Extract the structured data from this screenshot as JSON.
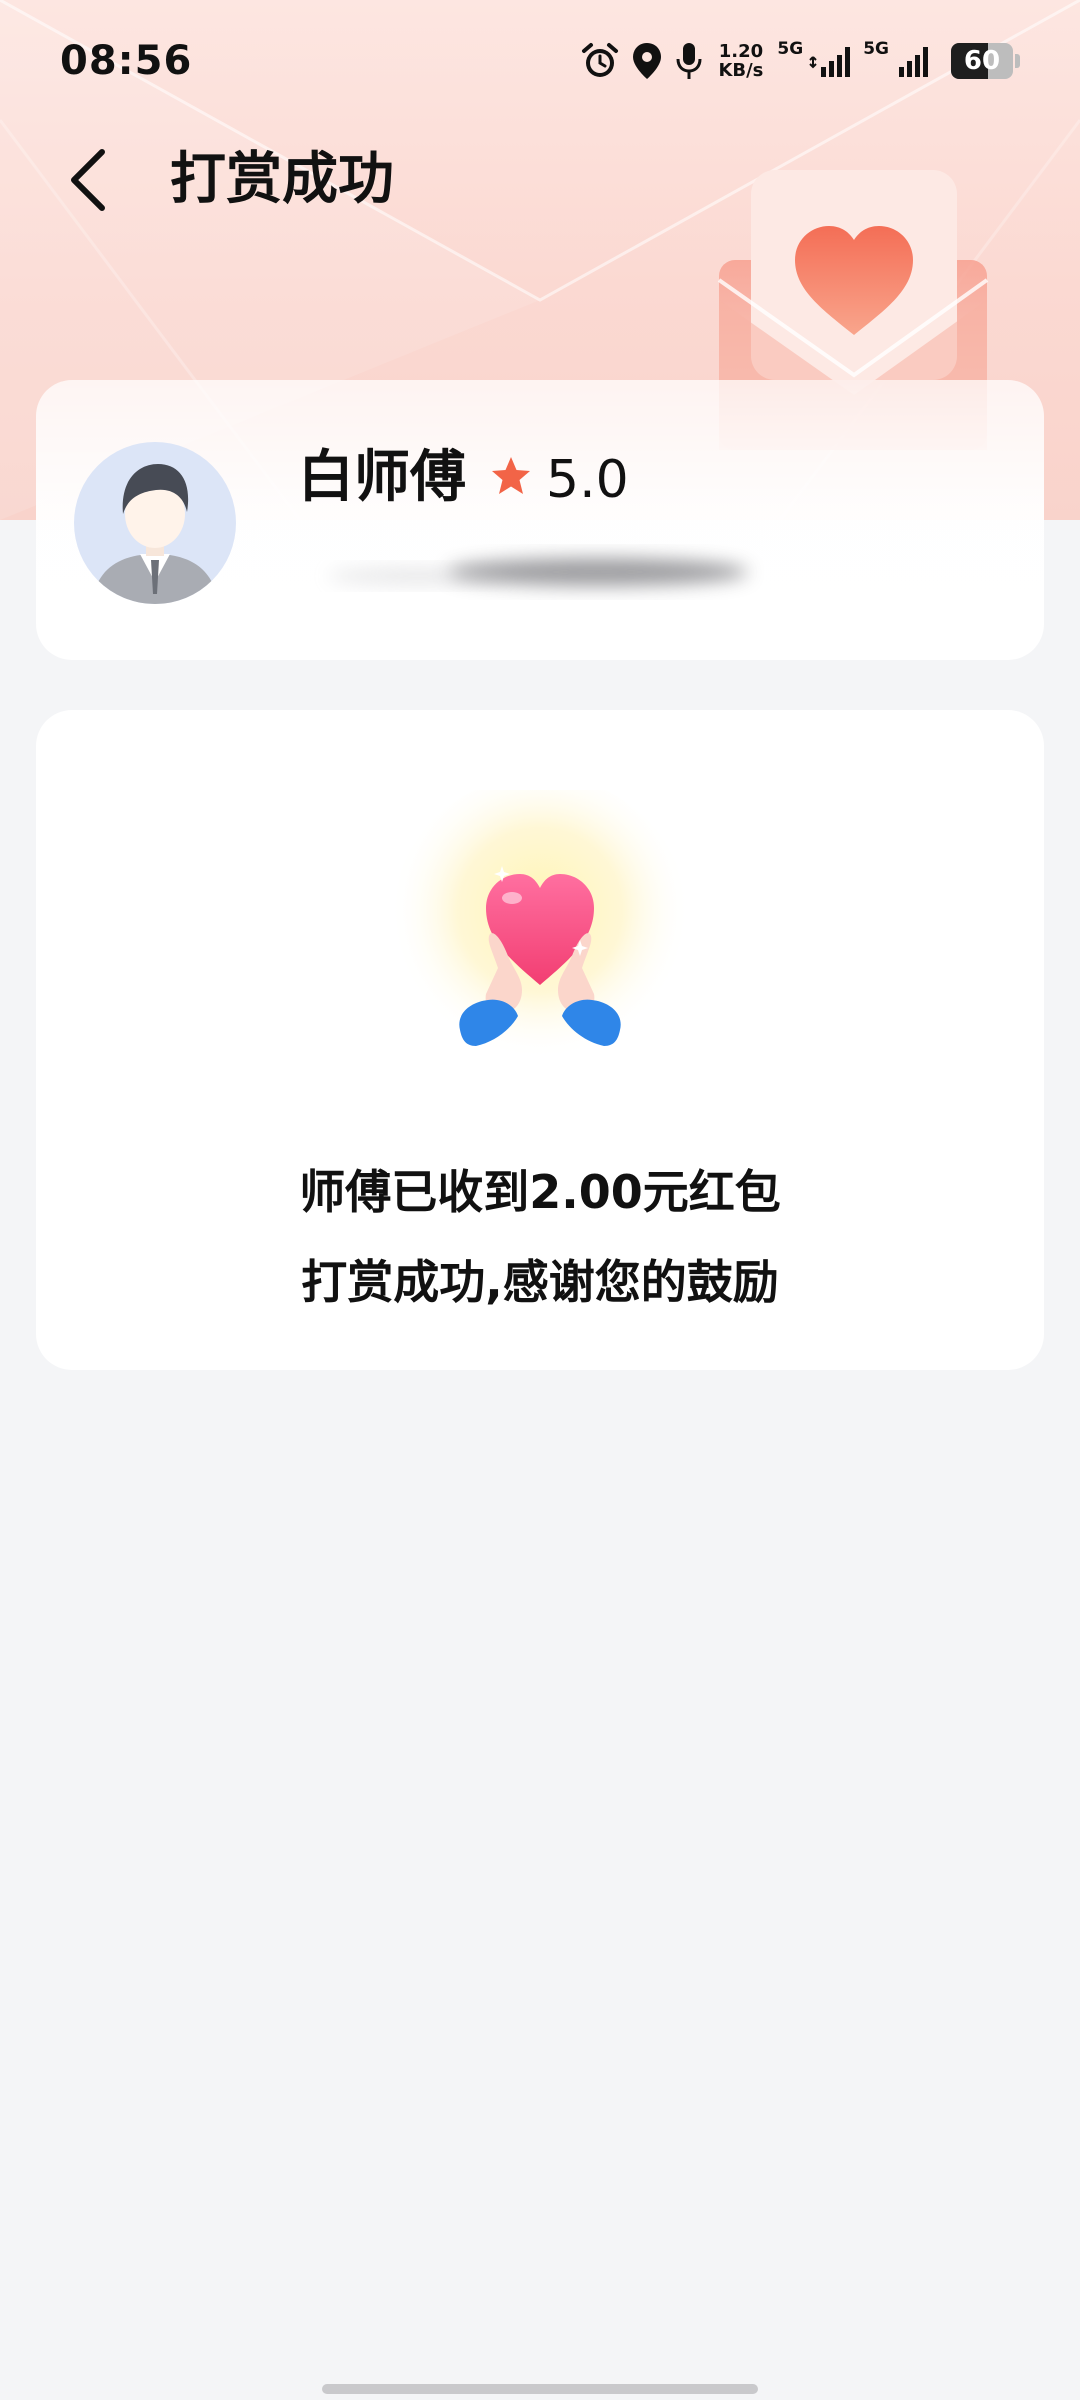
{
  "status_bar": {
    "time": "08:56",
    "net_speed_value": "1.20",
    "net_speed_unit": "KB/s",
    "signal_1_label": "5G",
    "signal_2_label": "5G",
    "battery_level": "60",
    "icons": [
      "alarm-icon",
      "location-icon",
      "microphone-icon",
      "signal-icon",
      "signal-icon",
      "battery-icon"
    ]
  },
  "header": {
    "title": "打赏成功",
    "back_icon": "chevron-left-icon"
  },
  "driver": {
    "name": "白师傅",
    "rating": "5.0",
    "rating_icon": "star-icon"
  },
  "result": {
    "line1": "师傅已收到2.00元红包",
    "line2": "打赏成功,感谢您的鼓励"
  },
  "colors": {
    "hero_bg": "#fbd9d2",
    "accent": "#f0705a",
    "heart": "#ff5a8a",
    "cuff": "#2f86e8",
    "page_bg": "#f4f5f7",
    "card_bg": "#ffffff"
  }
}
